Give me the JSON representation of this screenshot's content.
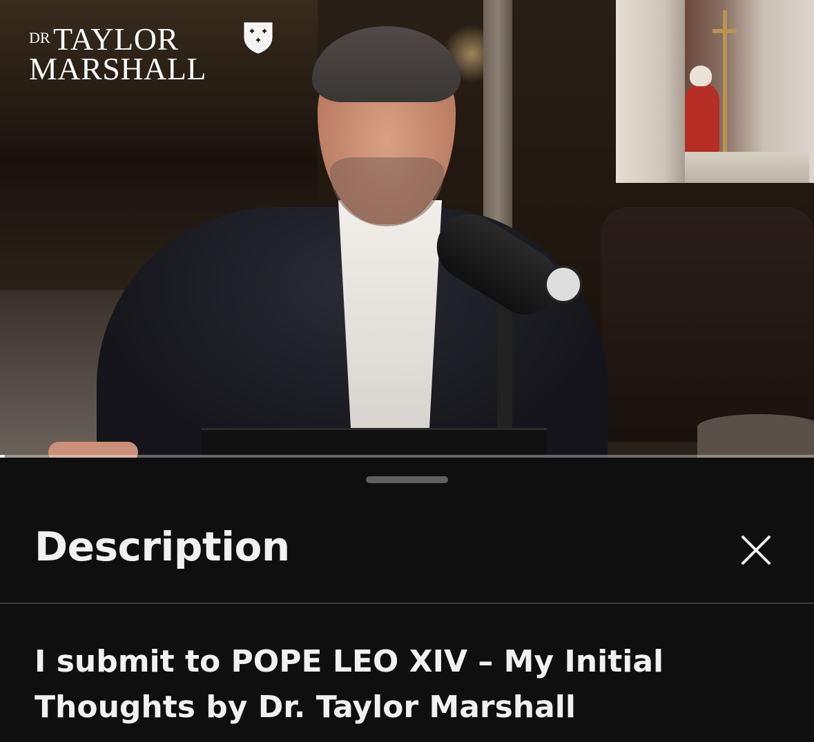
{
  "video": {
    "logo": {
      "prefix": "DR",
      "line1": "TAYLOR",
      "line2": "MARSHALL"
    },
    "progress_fraction": 0.006
  },
  "sheet": {
    "title": "Description",
    "close_icon": "close-icon",
    "video_title": "I submit to POPE LEO XIV – My Initial Thoughts by Dr. Taylor Marshall"
  },
  "colors": {
    "sheet_background": "#0f0f0f",
    "text": "#f1f1f1",
    "divider": "#3a3a3a",
    "progress_played": "#ffffff"
  }
}
